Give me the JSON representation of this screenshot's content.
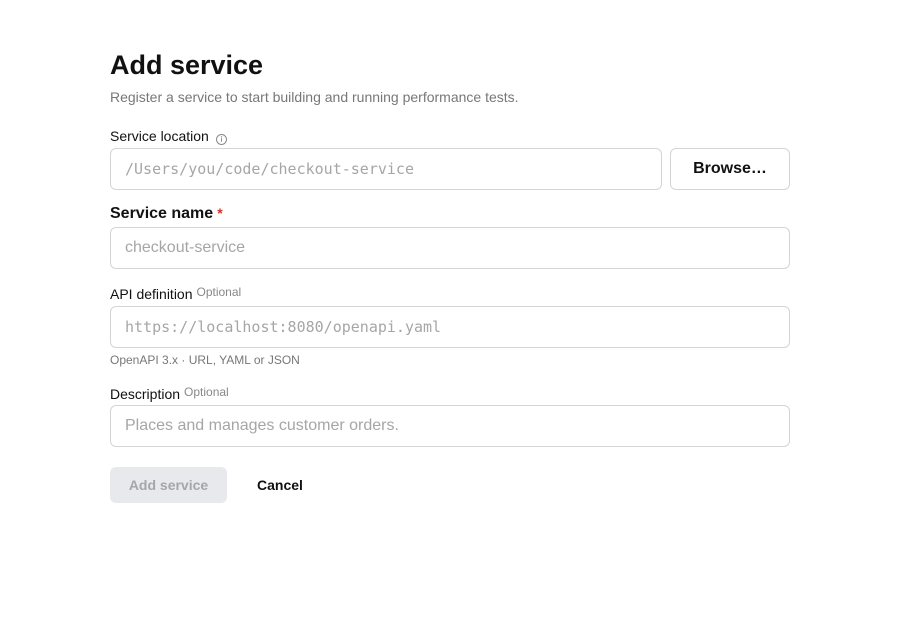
{
  "header": {
    "title": "Add service",
    "subtitle": "Register a service to start building and running performance tests."
  },
  "fields": {
    "service_location": {
      "label": "Service location",
      "info_icon": "info-circle-icon",
      "value": "",
      "placeholder": "/Users/you/code/checkout-service",
      "browse_label": "Browse…"
    },
    "service_name": {
      "label": "Service name",
      "required_marker": "*",
      "value": "",
      "placeholder": "checkout-service"
    },
    "api_definition": {
      "label": "API definition",
      "optional_tag": "Optional",
      "value": "",
      "placeholder": "https://localhost:8080/openapi.yaml",
      "hint": "OpenAPI 3.x · URL, YAML or JSON"
    },
    "description": {
      "label": "Description",
      "optional_tag": "Optional",
      "value": "",
      "placeholder": "Places and manages customer orders."
    }
  },
  "actions": {
    "submit_label": "Add service",
    "submit_disabled": true,
    "cancel_label": "Cancel"
  },
  "colors": {
    "required": "#d93025",
    "border": "#d4d4d4",
    "placeholder": "#a6a6a6",
    "disabled_button_bg": "#e8e9ec",
    "disabled_button_text": "#a4a6ab"
  }
}
